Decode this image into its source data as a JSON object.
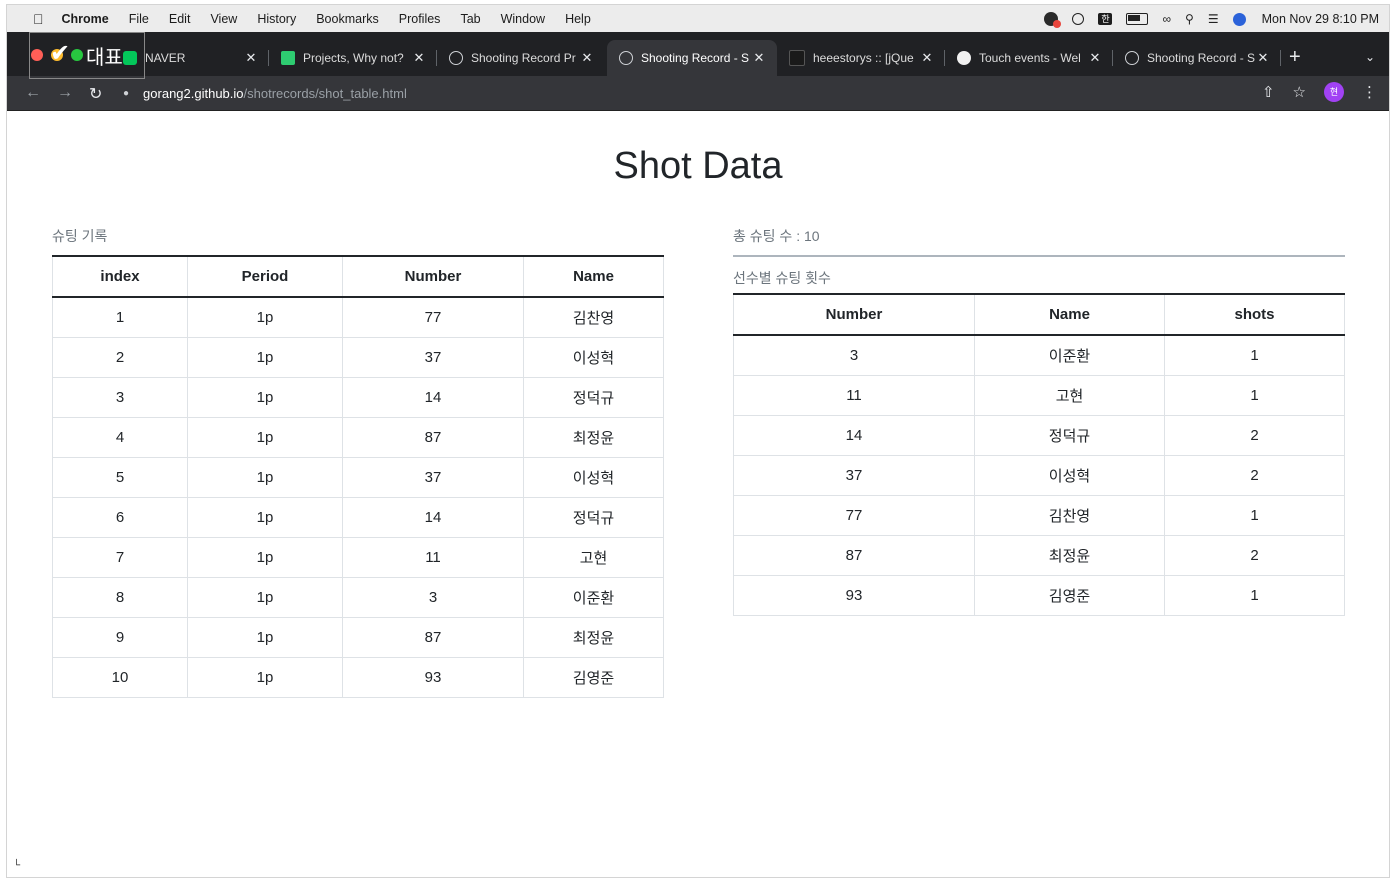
{
  "menubar": {
    "items": [
      "Chrome",
      "File",
      "Edit",
      "View",
      "History",
      "Bookmarks",
      "Profiles",
      "Tab",
      "Window",
      "Help"
    ],
    "status_hangul": "한",
    "clock": "Mon Nov 29  8:10 PM"
  },
  "overlay": {
    "label": "대표"
  },
  "tabs": [
    {
      "label": "NAVER",
      "icon": "naver-icon"
    },
    {
      "label": "Projects, Why not?",
      "icon": "projects-icon"
    },
    {
      "label": "Shooting Record Pr",
      "icon": "globe-icon"
    },
    {
      "label": "Shooting Record - S",
      "icon": "globe-icon",
      "active": true
    },
    {
      "label": "heeestorys :: [jQue",
      "icon": "tistory-icon"
    },
    {
      "label": "Touch events - Wel",
      "icon": "mdn-icon"
    },
    {
      "label": "Shooting Record - S",
      "icon": "globe-icon"
    }
  ],
  "address": {
    "host": "gorang2.github.io",
    "path": "/shotrecords/shot_table.html"
  },
  "profile": {
    "initial": "현"
  },
  "page": {
    "title": "Shot Data",
    "left_caption": "슈팅 기록",
    "total_caption": "총 슈팅 수 : 10",
    "per_player_caption": "선수별 슈팅 횟수"
  },
  "shot_table": {
    "headers": [
      "index",
      "Period",
      "Number",
      "Name"
    ],
    "rows": [
      [
        "1",
        "1p",
        "77",
        "김찬영"
      ],
      [
        "2",
        "1p",
        "37",
        "이성혁"
      ],
      [
        "3",
        "1p",
        "14",
        "정덕규"
      ],
      [
        "4",
        "1p",
        "87",
        "최정윤"
      ],
      [
        "5",
        "1p",
        "37",
        "이성혁"
      ],
      [
        "6",
        "1p",
        "14",
        "정덕규"
      ],
      [
        "7",
        "1p",
        "11",
        "고현"
      ],
      [
        "8",
        "1p",
        "3",
        "이준환"
      ],
      [
        "9",
        "1p",
        "87",
        "최정윤"
      ],
      [
        "10",
        "1p",
        "93",
        "김영준"
      ]
    ]
  },
  "player_table": {
    "headers": [
      "Number",
      "Name",
      "shots"
    ],
    "rows": [
      [
        "3",
        "이준환",
        "1"
      ],
      [
        "11",
        "고현",
        "1"
      ],
      [
        "14",
        "정덕규",
        "2"
      ],
      [
        "37",
        "이성혁",
        "2"
      ],
      [
        "77",
        "김찬영",
        "1"
      ],
      [
        "87",
        "최정윤",
        "2"
      ],
      [
        "93",
        "김영준",
        "1"
      ]
    ]
  }
}
